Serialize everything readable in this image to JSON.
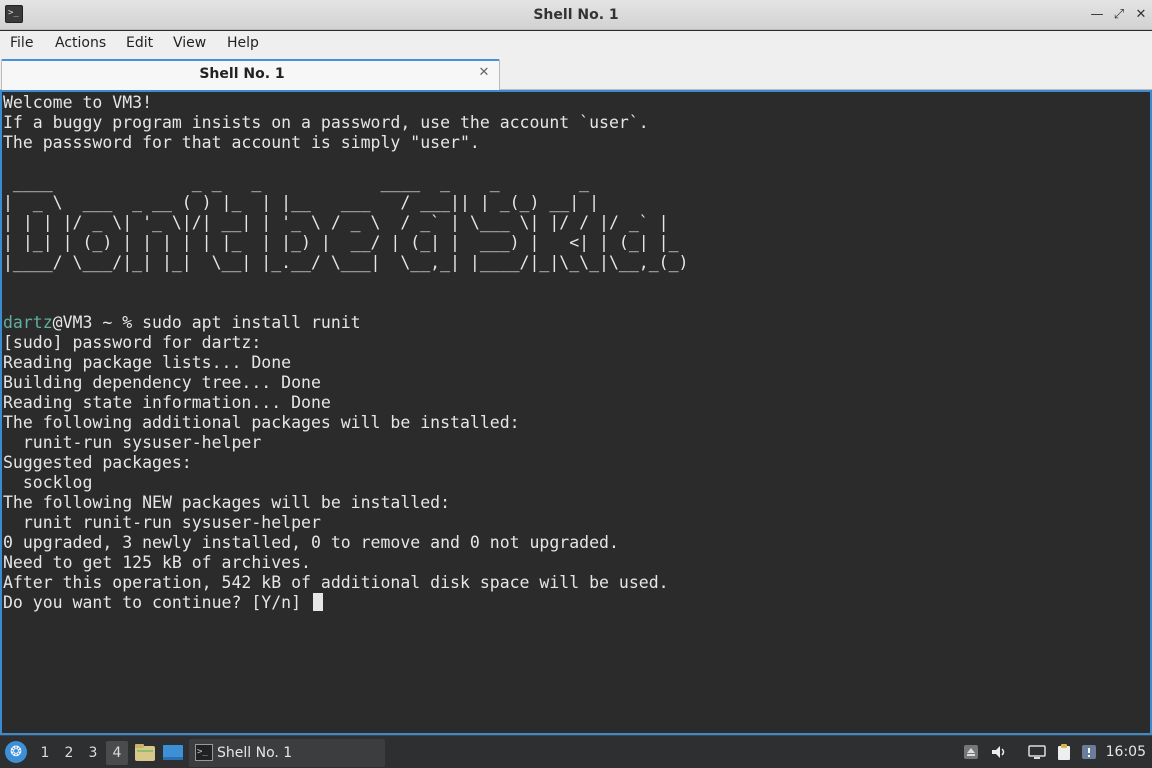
{
  "window": {
    "title": "Shell No. 1",
    "icon_glyph": ">_",
    "minimize_glyph": "—",
    "maximize_glyph": "⤢",
    "close_glyph": "✕"
  },
  "menu": [
    "File",
    "Actions",
    "Edit",
    "View",
    "Help"
  ],
  "tab": {
    "label": "Shell No. 1",
    "close_glyph": "✕"
  },
  "terminal": {
    "prompt_user": "dartz",
    "prompt_rest": "@VM3 ~ % sudo apt install runit",
    "lines_before": [
      "Welcome to VM3!",
      "If a buggy program insists on a password, use the account `user`.",
      "The passsword for that account is simply \"user\".",
      "",
      " ____              _ _   _            ____  _    _        _ ",
      "|  _ \\  ___  _ __ ( ) |_  | |__   ___   / ___|| | _(_) __| |",
      "| | | |/ _ \\| '_ \\|/| __| | '_ \\ / _ \\  / _` | \\___ \\| |/ / |/ _` |",
      "| |_| | (_) | | | | | |_  | |_) |  __/ | (_| |  ___) |   <| | (_| |_",
      "|____/ \\___/|_| |_|  \\__| |_.__/ \\___|  \\__,_| |____/|_|\\_\\_|\\__,_(_)",
      ""
    ],
    "lines_after": [
      "[sudo] password for dartz:",
      "Reading package lists... Done",
      "Building dependency tree... Done",
      "Reading state information... Done",
      "The following additional packages will be installed:",
      "  runit-run sysuser-helper",
      "Suggested packages:",
      "  socklog",
      "The following NEW packages will be installed:",
      "  runit runit-run sysuser-helper",
      "0 upgraded, 3 newly installed, 0 to remove and 0 not upgraded.",
      "Need to get 125 kB of archives.",
      "After this operation, 542 kB of additional disk space will be used.",
      "Do you want to continue? [Y/n] "
    ],
    "colors": {
      "background": "#2b2b2b",
      "foreground": "#e6e6e6",
      "prompt_user": "#5fb0a0"
    }
  },
  "taskbar": {
    "start_glyph": "❂",
    "workspaces": [
      "1",
      "2",
      "3",
      "4"
    ],
    "active_workspace": "4",
    "task_label": "Shell No. 1",
    "clock": "16:05",
    "tray_icons": [
      "upload-icon",
      "volume-icon",
      "network-icon",
      "clipboard-icon",
      "notification-icon"
    ]
  }
}
